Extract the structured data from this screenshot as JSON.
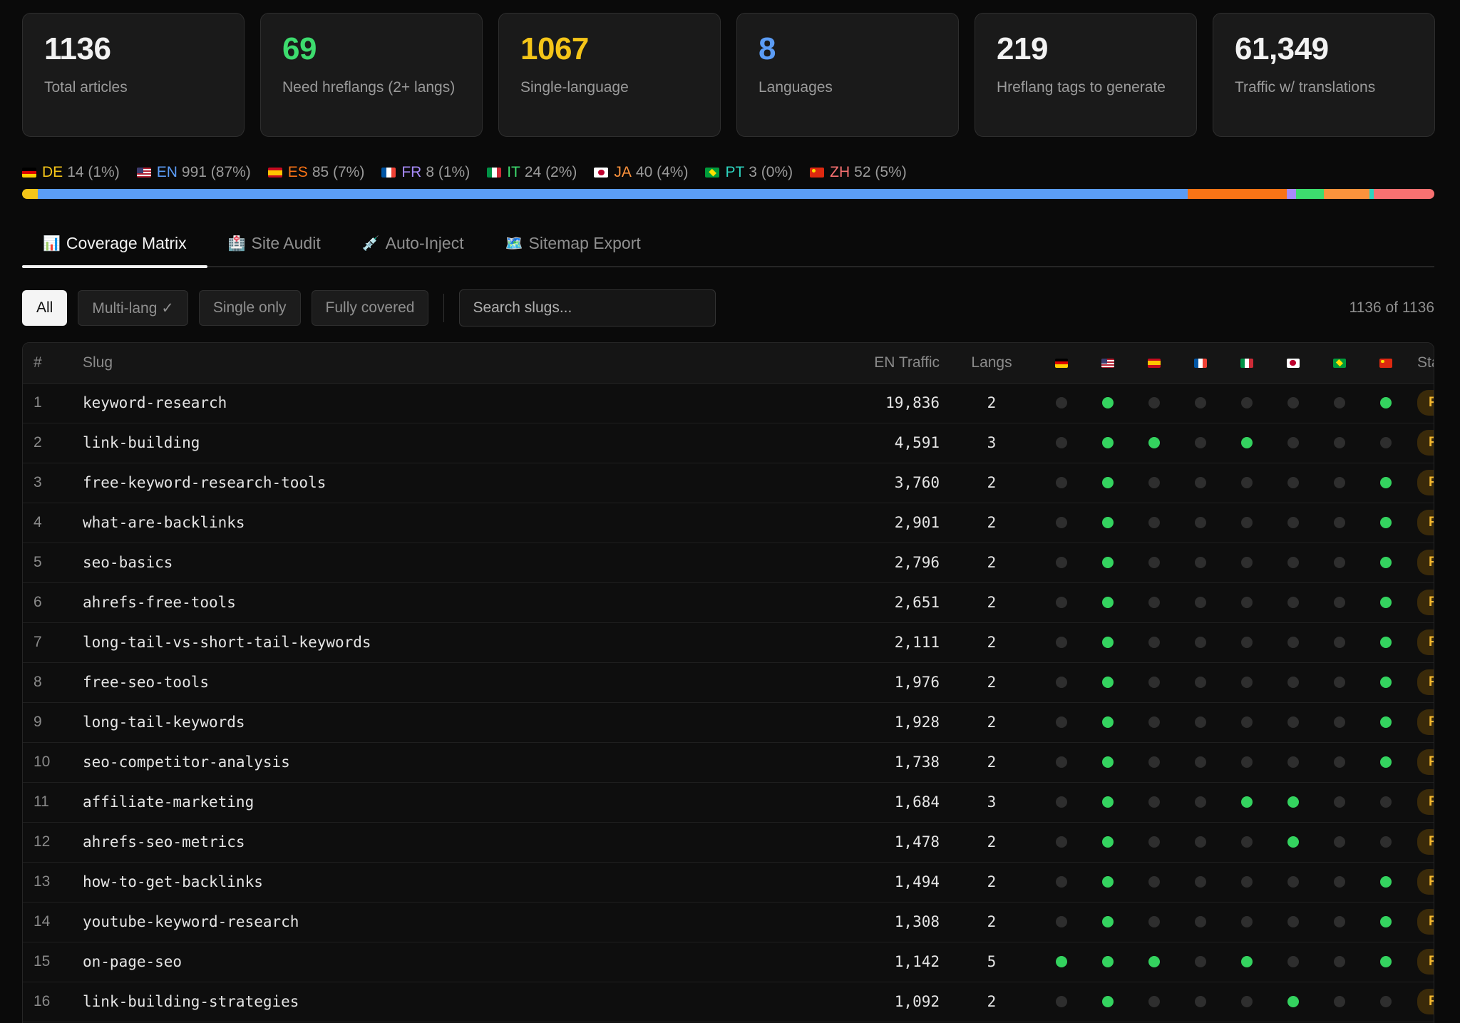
{
  "stats": [
    {
      "value": "1136",
      "label": "Total articles",
      "color": "#f2f2f2"
    },
    {
      "value": "69",
      "label": "Need hreflangs (2+ langs)",
      "color": "#3ddc6e"
    },
    {
      "value": "1067",
      "label": "Single-language",
      "color": "#f5c518"
    },
    {
      "value": "8",
      "label": "Languages",
      "color": "#5b9cf5"
    },
    {
      "value": "219",
      "label": "Hreflang tags to generate",
      "color": "#f2f2f2"
    },
    {
      "value": "61,349",
      "label": "Traffic w/ translations",
      "color": "#f2f2f2"
    }
  ],
  "languages": [
    {
      "code": "DE",
      "count": "14 (1%)",
      "share": 1.2,
      "color": "#f5c518",
      "flag": "de"
    },
    {
      "code": "EN",
      "count": "991 (87%)",
      "share": 87.2,
      "color": "#5b9cf5",
      "flag": "us"
    },
    {
      "code": "ES",
      "count": "85 (7%)",
      "share": 7.5,
      "color": "#f97316",
      "flag": "es"
    },
    {
      "code": "FR",
      "count": "8 (1%)",
      "share": 0.7,
      "color": "#a78bfa",
      "flag": "fr"
    },
    {
      "code": "IT",
      "count": "24 (2%)",
      "share": 2.1,
      "color": "#3ddc6e",
      "flag": "it"
    },
    {
      "code": "JA",
      "count": "40 (4%)",
      "share": 3.5,
      "color": "#fb923c",
      "flag": "jp"
    },
    {
      "code": "PT",
      "count": "3 (0%)",
      "share": 0.3,
      "color": "#2dd4bf",
      "flag": "br"
    },
    {
      "code": "ZH",
      "count": "52 (5%)",
      "share": 4.6,
      "color": "#f87171",
      "flag": "cn"
    }
  ],
  "tabs": [
    {
      "label": "Coverage Matrix",
      "icon": "📊",
      "icon_name": "bar-chart-icon",
      "active": true
    },
    {
      "label": "Site Audit",
      "icon": "🏥",
      "icon_name": "hospital-icon",
      "active": false
    },
    {
      "label": "Auto-Inject",
      "icon": "💉",
      "icon_name": "syringe-icon",
      "active": false
    },
    {
      "label": "Sitemap Export",
      "icon": "🗺️",
      "icon_name": "map-icon",
      "active": false
    }
  ],
  "filters": {
    "buttons": [
      {
        "label": "All",
        "active": true
      },
      {
        "label": "Multi-lang ✓",
        "active": false
      },
      {
        "label": "Single only",
        "active": false
      },
      {
        "label": "Fully covered",
        "active": false
      }
    ],
    "search_placeholder": "Search slugs...",
    "count_text": "1136 of 1136"
  },
  "table": {
    "headers": {
      "idx": "#",
      "slug": "Slug",
      "traffic": "EN Traffic",
      "langs": "Langs",
      "status": "Status"
    },
    "lang_order": [
      "de",
      "us",
      "es",
      "fr",
      "it",
      "jp",
      "br",
      "cn"
    ],
    "rows": [
      {
        "idx": "1",
        "slug": "keyword-research",
        "traffic": "19,836",
        "langs": "2",
        "coverage": [
          0,
          1,
          0,
          0,
          0,
          0,
          0,
          1
        ],
        "status": "Partial"
      },
      {
        "idx": "2",
        "slug": "link-building",
        "traffic": "4,591",
        "langs": "3",
        "coverage": [
          0,
          1,
          1,
          0,
          1,
          0,
          0,
          0
        ],
        "status": "Partial"
      },
      {
        "idx": "3",
        "slug": "free-keyword-research-tools",
        "traffic": "3,760",
        "langs": "2",
        "coverage": [
          0,
          1,
          0,
          0,
          0,
          0,
          0,
          1
        ],
        "status": "Partial"
      },
      {
        "idx": "4",
        "slug": "what-are-backlinks",
        "traffic": "2,901",
        "langs": "2",
        "coverage": [
          0,
          1,
          0,
          0,
          0,
          0,
          0,
          1
        ],
        "status": "Partial"
      },
      {
        "idx": "5",
        "slug": "seo-basics",
        "traffic": "2,796",
        "langs": "2",
        "coverage": [
          0,
          1,
          0,
          0,
          0,
          0,
          0,
          1
        ],
        "status": "Partial"
      },
      {
        "idx": "6",
        "slug": "ahrefs-free-tools",
        "traffic": "2,651",
        "langs": "2",
        "coverage": [
          0,
          1,
          0,
          0,
          0,
          0,
          0,
          1
        ],
        "status": "Partial"
      },
      {
        "idx": "7",
        "slug": "long-tail-vs-short-tail-keywords",
        "traffic": "2,111",
        "langs": "2",
        "coverage": [
          0,
          1,
          0,
          0,
          0,
          0,
          0,
          1
        ],
        "status": "Partial"
      },
      {
        "idx": "8",
        "slug": "free-seo-tools",
        "traffic": "1,976",
        "langs": "2",
        "coverage": [
          0,
          1,
          0,
          0,
          0,
          0,
          0,
          1
        ],
        "status": "Partial"
      },
      {
        "idx": "9",
        "slug": "long-tail-keywords",
        "traffic": "1,928",
        "langs": "2",
        "coverage": [
          0,
          1,
          0,
          0,
          0,
          0,
          0,
          1
        ],
        "status": "Partial"
      },
      {
        "idx": "10",
        "slug": "seo-competitor-analysis",
        "traffic": "1,738",
        "langs": "2",
        "coverage": [
          0,
          1,
          0,
          0,
          0,
          0,
          0,
          1
        ],
        "status": "Partial"
      },
      {
        "idx": "11",
        "slug": "affiliate-marketing",
        "traffic": "1,684",
        "langs": "3",
        "coverage": [
          0,
          1,
          0,
          0,
          1,
          1,
          0,
          0
        ],
        "status": "Partial"
      },
      {
        "idx": "12",
        "slug": "ahrefs-seo-metrics",
        "traffic": "1,478",
        "langs": "2",
        "coverage": [
          0,
          1,
          0,
          0,
          0,
          1,
          0,
          0
        ],
        "status": "Partial"
      },
      {
        "idx": "13",
        "slug": "how-to-get-backlinks",
        "traffic": "1,494",
        "langs": "2",
        "coverage": [
          0,
          1,
          0,
          0,
          0,
          0,
          0,
          1
        ],
        "status": "Partial"
      },
      {
        "idx": "14",
        "slug": "youtube-keyword-research",
        "traffic": "1,308",
        "langs": "2",
        "coverage": [
          0,
          1,
          0,
          0,
          0,
          0,
          0,
          1
        ],
        "status": "Partial"
      },
      {
        "idx": "15",
        "slug": "on-page-seo",
        "traffic": "1,142",
        "langs": "5",
        "coverage": [
          1,
          1,
          1,
          0,
          1,
          0,
          0,
          1
        ],
        "status": "Partial"
      },
      {
        "idx": "16",
        "slug": "link-building-strategies",
        "traffic": "1,092",
        "langs": "2",
        "coverage": [
          0,
          1,
          0,
          0,
          0,
          1,
          0,
          0
        ],
        "status": "Partial"
      }
    ]
  }
}
